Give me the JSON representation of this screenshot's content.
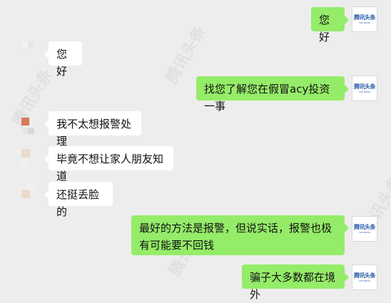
{
  "watermark": "腾讯头条",
  "brand": {
    "logo_text": "腾讯头条",
    "logo_sub": "TOP NEWS",
    "color": "#2a5ea8"
  },
  "colors": {
    "bubble_right": "#95ec69",
    "bubble_left": "#ffffff",
    "background": "#ededed"
  },
  "messages": [
    {
      "side": "right",
      "text": "您好"
    },
    {
      "side": "left",
      "text": "您好"
    },
    {
      "side": "right",
      "text": "找您了解您在假冒acy投资一事"
    },
    {
      "side": "left",
      "text": "我不太想报警处理"
    },
    {
      "side": "left",
      "text": "毕竟不想让家人朋友知道"
    },
    {
      "side": "left",
      "text": "还挺丢脸的"
    },
    {
      "side": "right",
      "text": "最好的方法是报警，但说实话，报警也极有可能要不回钱"
    },
    {
      "side": "right",
      "text": "骗子大多数都在境外"
    }
  ]
}
